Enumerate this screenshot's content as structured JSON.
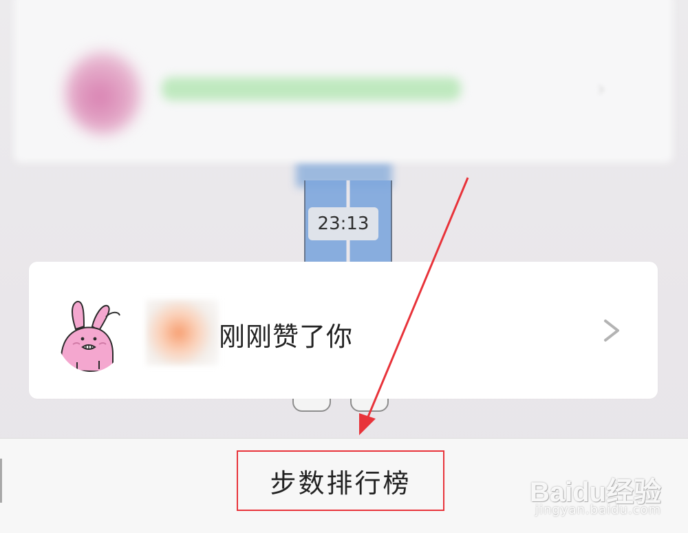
{
  "notification": {
    "time": "23:13",
    "message": "刚刚赞了你"
  },
  "bottom": {
    "rank_label": "步数排行榜"
  },
  "watermark": {
    "logo": "Baidu经验",
    "url": "jingyan.baidu.com"
  },
  "colors": {
    "highlight": "#e8333a",
    "card": "#ffffff",
    "time_chip": "#dfe3ea"
  },
  "icons": [
    "rabbit-avatar-icon",
    "chevron-right-icon",
    "red-arrow-icon"
  ]
}
